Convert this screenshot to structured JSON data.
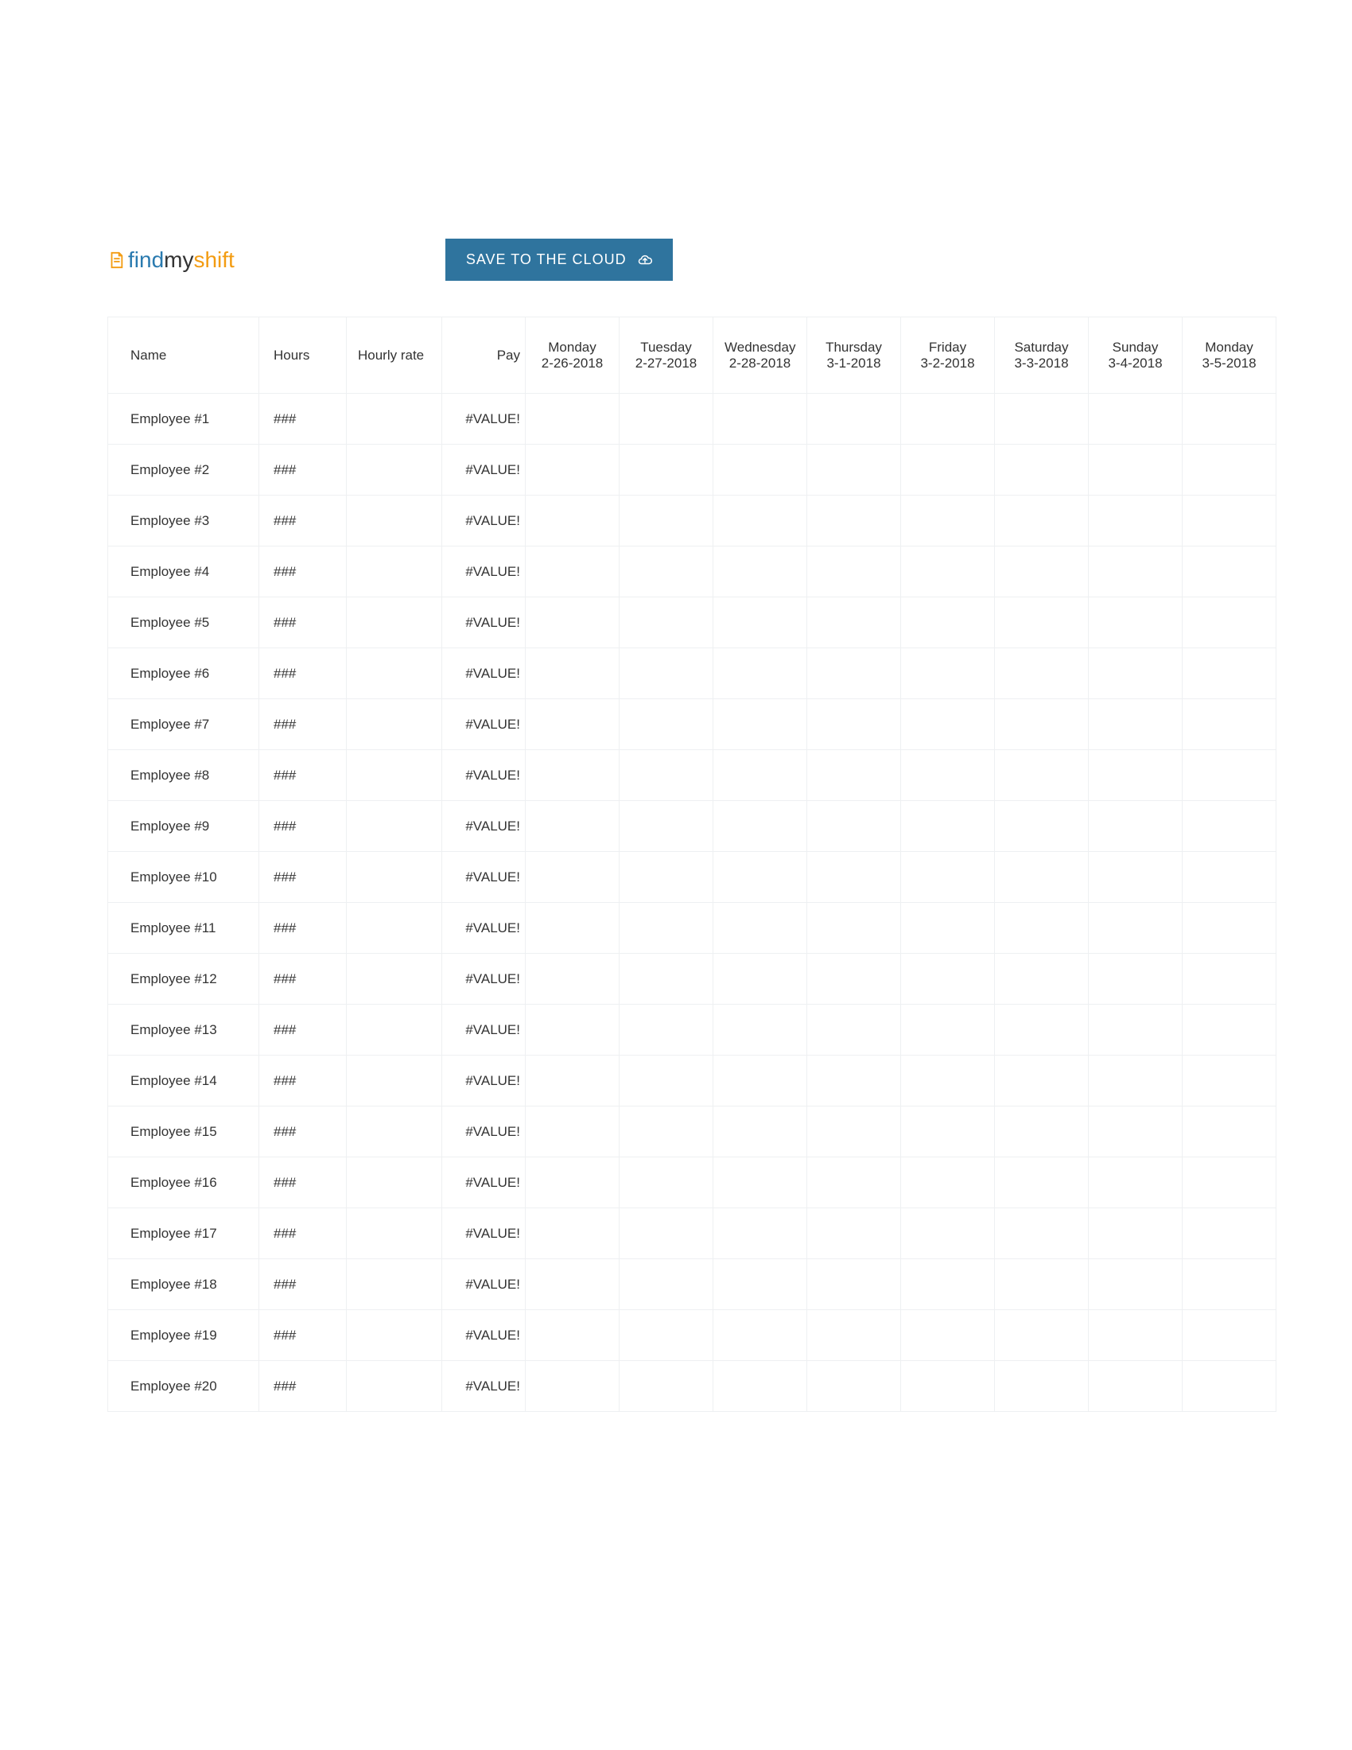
{
  "logo": {
    "part1": "find",
    "part2": "my",
    "part3": "shift"
  },
  "save_button": {
    "label": "SAVE TO THE CLOUD"
  },
  "table": {
    "headers": {
      "name": "Name",
      "hours": "Hours",
      "hourly_rate": "Hourly rate",
      "pay": "Pay",
      "days": [
        {
          "weekday": "Monday",
          "date": "2-26-2018"
        },
        {
          "weekday": "Tuesday",
          "date": "2-27-2018"
        },
        {
          "weekday": "Wednesday",
          "date": "2-28-2018"
        },
        {
          "weekday": "Thursday",
          "date": "3-1-2018"
        },
        {
          "weekday": "Friday",
          "date": "3-2-2018"
        },
        {
          "weekday": "Saturday",
          "date": "3-3-2018"
        },
        {
          "weekday": "Sunday",
          "date": "3-4-2018"
        },
        {
          "weekday": "Monday",
          "date": "3-5-2018"
        }
      ]
    },
    "rows": [
      {
        "name": "Employee #1",
        "hours": "###",
        "hourly_rate": "",
        "pay": "#VALUE!",
        "days": [
          "",
          "",
          "",
          "",
          "",
          "",
          "",
          ""
        ]
      },
      {
        "name": "Employee #2",
        "hours": "###",
        "hourly_rate": "",
        "pay": "#VALUE!",
        "days": [
          "",
          "",
          "",
          "",
          "",
          "",
          "",
          ""
        ]
      },
      {
        "name": "Employee #3",
        "hours": "###",
        "hourly_rate": "",
        "pay": "#VALUE!",
        "days": [
          "",
          "",
          "",
          "",
          "",
          "",
          "",
          ""
        ]
      },
      {
        "name": "Employee #4",
        "hours": "###",
        "hourly_rate": "",
        "pay": "#VALUE!",
        "days": [
          "",
          "",
          "",
          "",
          "",
          "",
          "",
          ""
        ]
      },
      {
        "name": "Employee #5",
        "hours": "###",
        "hourly_rate": "",
        "pay": "#VALUE!",
        "days": [
          "",
          "",
          "",
          "",
          "",
          "",
          "",
          ""
        ]
      },
      {
        "name": "Employee #6",
        "hours": "###",
        "hourly_rate": "",
        "pay": "#VALUE!",
        "days": [
          "",
          "",
          "",
          "",
          "",
          "",
          "",
          ""
        ]
      },
      {
        "name": "Employee #7",
        "hours": "###",
        "hourly_rate": "",
        "pay": "#VALUE!",
        "days": [
          "",
          "",
          "",
          "",
          "",
          "",
          "",
          ""
        ]
      },
      {
        "name": "Employee #8",
        "hours": "###",
        "hourly_rate": "",
        "pay": "#VALUE!",
        "days": [
          "",
          "",
          "",
          "",
          "",
          "",
          "",
          ""
        ]
      },
      {
        "name": "Employee #9",
        "hours": "###",
        "hourly_rate": "",
        "pay": "#VALUE!",
        "days": [
          "",
          "",
          "",
          "",
          "",
          "",
          "",
          ""
        ]
      },
      {
        "name": "Employee #10",
        "hours": "###",
        "hourly_rate": "",
        "pay": "#VALUE!",
        "days": [
          "",
          "",
          "",
          "",
          "",
          "",
          "",
          ""
        ]
      },
      {
        "name": "Employee #11",
        "hours": "###",
        "hourly_rate": "",
        "pay": "#VALUE!",
        "days": [
          "",
          "",
          "",
          "",
          "",
          "",
          "",
          ""
        ]
      },
      {
        "name": "Employee #12",
        "hours": "###",
        "hourly_rate": "",
        "pay": "#VALUE!",
        "days": [
          "",
          "",
          "",
          "",
          "",
          "",
          "",
          ""
        ]
      },
      {
        "name": "Employee #13",
        "hours": "###",
        "hourly_rate": "",
        "pay": "#VALUE!",
        "days": [
          "",
          "",
          "",
          "",
          "",
          "",
          "",
          ""
        ]
      },
      {
        "name": "Employee #14",
        "hours": "###",
        "hourly_rate": "",
        "pay": "#VALUE!",
        "days": [
          "",
          "",
          "",
          "",
          "",
          "",
          "",
          ""
        ]
      },
      {
        "name": "Employee #15",
        "hours": "###",
        "hourly_rate": "",
        "pay": "#VALUE!",
        "days": [
          "",
          "",
          "",
          "",
          "",
          "",
          "",
          ""
        ]
      },
      {
        "name": "Employee #16",
        "hours": "###",
        "hourly_rate": "",
        "pay": "#VALUE!",
        "days": [
          "",
          "",
          "",
          "",
          "",
          "",
          "",
          ""
        ]
      },
      {
        "name": "Employee #17",
        "hours": "###",
        "hourly_rate": "",
        "pay": "#VALUE!",
        "days": [
          "",
          "",
          "",
          "",
          "",
          "",
          "",
          ""
        ]
      },
      {
        "name": "Employee #18",
        "hours": "###",
        "hourly_rate": "",
        "pay": "#VALUE!",
        "days": [
          "",
          "",
          "",
          "",
          "",
          "",
          "",
          ""
        ]
      },
      {
        "name": "Employee #19",
        "hours": "###",
        "hourly_rate": "",
        "pay": "#VALUE!",
        "days": [
          "",
          "",
          "",
          "",
          "",
          "",
          "",
          ""
        ]
      },
      {
        "name": "Employee #20",
        "hours": "###",
        "hourly_rate": "",
        "pay": "#VALUE!",
        "days": [
          "",
          "",
          "",
          "",
          "",
          "",
          "",
          ""
        ]
      }
    ]
  }
}
